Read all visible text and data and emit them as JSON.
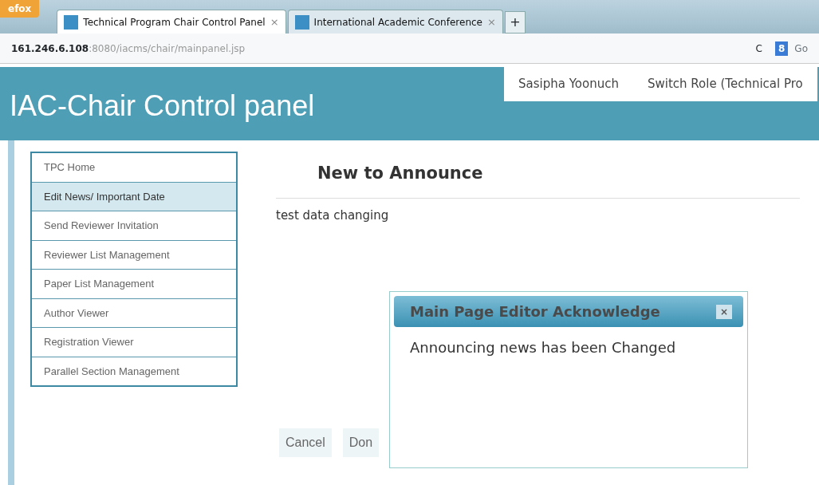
{
  "browser": {
    "menu_button": "efox",
    "tabs": [
      {
        "title": "Technical Program Chair Control Panel",
        "close": "×",
        "selected": true
      },
      {
        "title": "International Academic Conference",
        "close": "×",
        "selected": false
      }
    ],
    "new_tab": "+",
    "address": {
      "host": "161.246.6.108",
      "rest": ":8080/iacms/chair/mainpanel.jsp"
    },
    "reload": "C",
    "search_engine": "8",
    "search_text": "Go"
  },
  "header": {
    "title": "IAC-Chair Control panel",
    "links": [
      "Sasipha Yoonuch",
      "Switch Role (Technical Pro"
    ]
  },
  "sidebar": {
    "items": [
      {
        "label": "TPC Home",
        "selected": false
      },
      {
        "label": "Edit News/ Important Date",
        "selected": true
      },
      {
        "label": "Send Reviewer Invitation",
        "selected": false
      },
      {
        "label": "Reviewer List Management",
        "selected": false
      },
      {
        "label": "Paper List Management",
        "selected": false
      },
      {
        "label": "Author Viewer",
        "selected": false
      },
      {
        "label": "Registration Viewer",
        "selected": false
      },
      {
        "label": "Parallel Section Management",
        "selected": false
      }
    ]
  },
  "content": {
    "heading": "New to Announce",
    "text": "test data changing",
    "buttons": [
      "Cancel",
      "Don"
    ]
  },
  "dialog": {
    "title": "Main Page Editor Acknowledge",
    "close": "×",
    "message": "Announcing news has been Changed"
  }
}
